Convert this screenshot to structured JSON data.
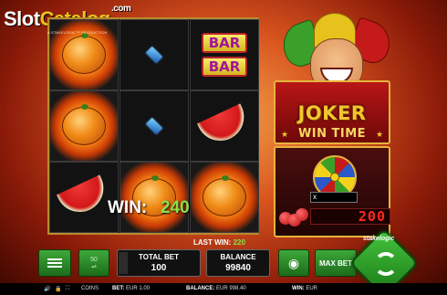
{
  "logo": {
    "slot": "Slot",
    "catalog": "Catalog",
    "com": ".com"
  },
  "production": "A STAKELOGIC™ PRODUCTION",
  "reels": {
    "col1": [
      "orange",
      "orange",
      "watermelon"
    ],
    "col2": [
      "blue-diamond",
      "blue-diamond",
      "orange"
    ],
    "col3": [
      "bar",
      "watermelon",
      "orange"
    ],
    "bar_label": "BAR"
  },
  "win": {
    "label": "WIN:",
    "value": "240"
  },
  "joker": {
    "title": "JOKER",
    "subtitle": "WIN TIME",
    "multiplier": "x",
    "counter": "200"
  },
  "last_win": {
    "label": "LAST WIN:",
    "value": "220"
  },
  "controls": {
    "lines": "50",
    "total_bet_label": "TOTAL BET",
    "total_bet_value": "100",
    "balance_label": "BALANCE",
    "balance_value": "99840",
    "max_bet_label": "MAX BET",
    "brand": "stakelogic"
  },
  "footer": {
    "coins": "COINS",
    "bet_label": "BET:",
    "bet_value": "EUR 1.00",
    "balance_label": "BALANCE:",
    "balance_value": "EUR 998.40",
    "win_label": "WIN:",
    "win_value": "EUR"
  },
  "colors": {
    "accent_green": "#3da83a",
    "win_green": "#8ce04a",
    "gold": "#f1c52e",
    "led_red": "#ff2a1a"
  }
}
